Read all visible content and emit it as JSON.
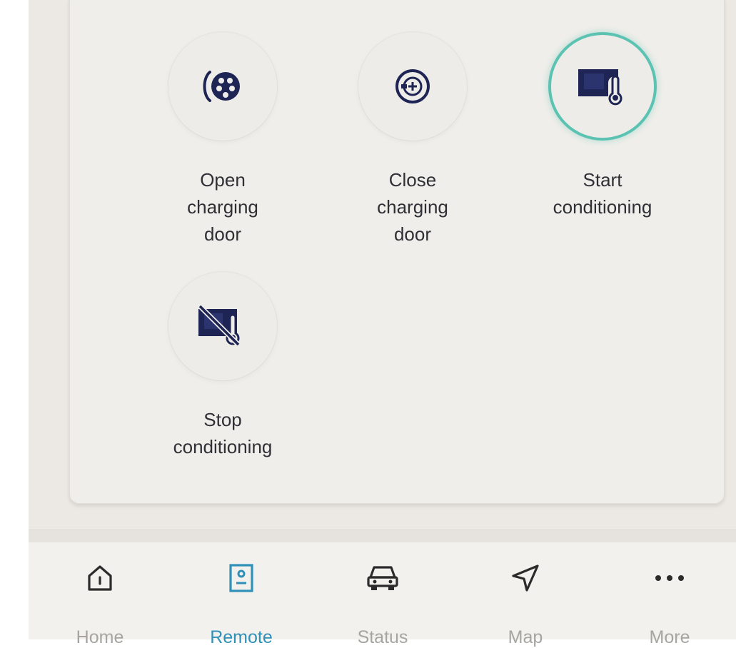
{
  "actions": [
    {
      "label": "Open\ncharging\ndoor",
      "icon": "open-charging-door-icon"
    },
    {
      "label": "Close\ncharging\ndoor",
      "icon": "close-charging-door-icon"
    },
    {
      "label": "Start\nconditioning",
      "icon": "start-conditioning-icon"
    },
    {
      "label": "Stop\nconditioning",
      "icon": "stop-conditioning-icon"
    }
  ],
  "nav": {
    "items": [
      {
        "label": "Home",
        "icon": "home-icon"
      },
      {
        "label": "Remote",
        "icon": "remote-icon"
      },
      {
        "label": "Status",
        "icon": "car-icon"
      },
      {
        "label": "Map",
        "icon": "navigation-arrow-icon"
      },
      {
        "label": "More",
        "icon": "more-dots-icon"
      }
    ],
    "active": "Remote"
  },
  "colors": {
    "icon_navy": "#1e2453",
    "active_ring": "#5cc3b3",
    "nav_active": "#2f90b8",
    "nav_inactive": "#a7a5a1"
  }
}
